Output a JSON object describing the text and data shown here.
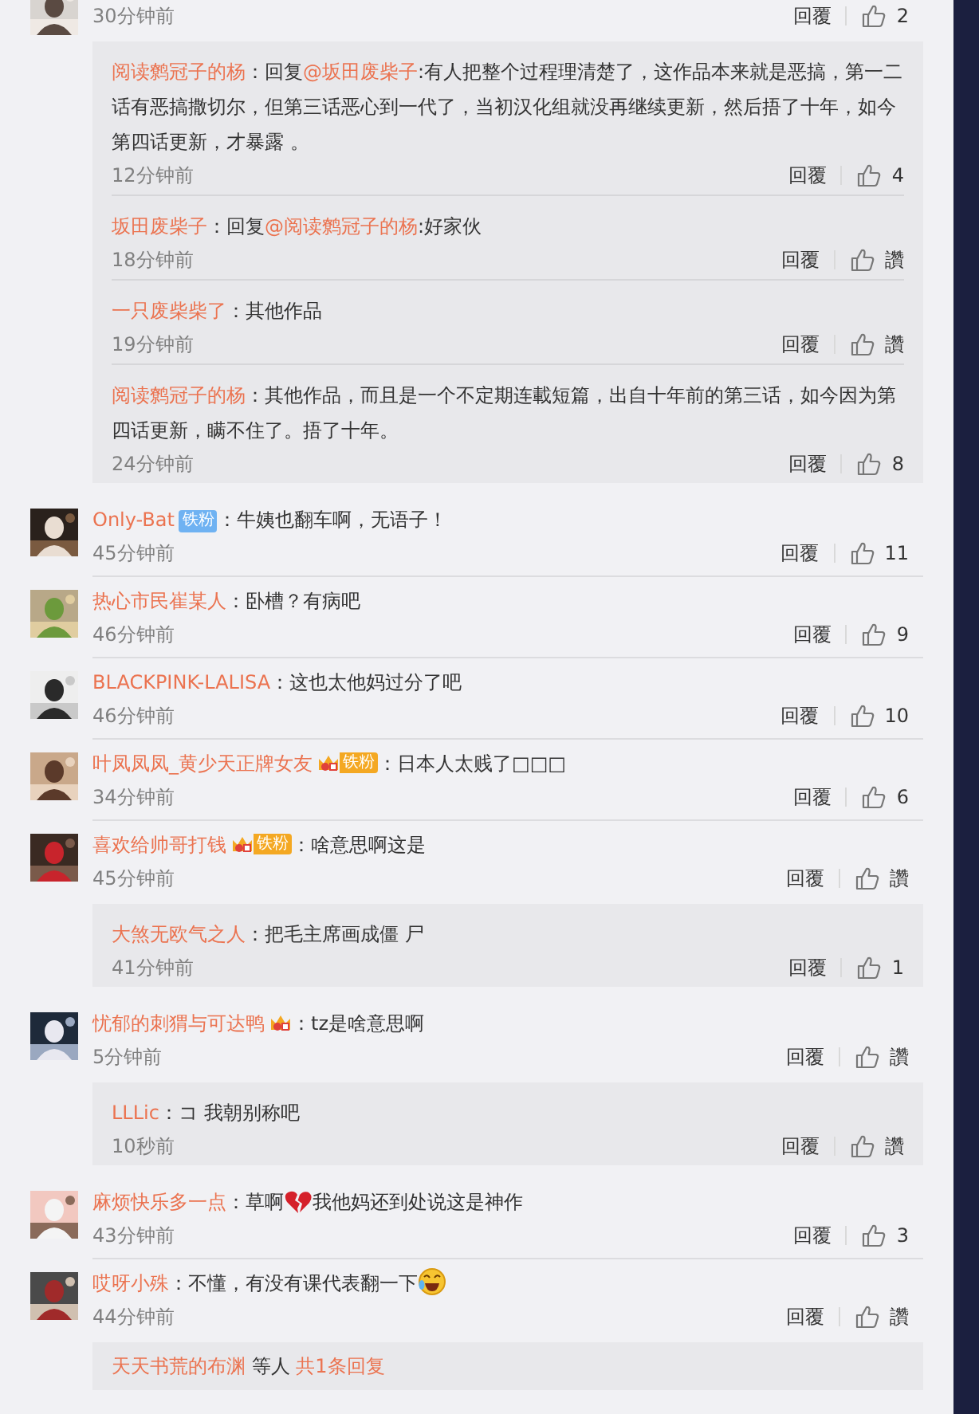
{
  "comments": [
    {
      "time": "30分钟前",
      "reply_label": "回覆",
      "likes": "2",
      "replies": [
        {
          "user": "阅读鹩冠子的杨",
          "prefix": "：回复",
          "mention": "@坂田废柴子",
          "text": ":有人把整个过程理清楚了，这作品本来就是恶搞，第一二话有恶搞撒切尔，但第三话恶心到一代了，当初汉化组就没再继续更新，然后捂了十年，如今第四话更新，才暴露 。",
          "time": "12分钟前",
          "reply_label": "回覆",
          "likes": "4"
        },
        {
          "user": "坂田废柴子",
          "prefix": "：回复",
          "mention": "@阅读鹩冠子的杨",
          "text": ":好家伙",
          "time": "18分钟前",
          "reply_label": "回覆",
          "likes": "讚"
        },
        {
          "user": "一只废柴柴了",
          "text": "：其他作品",
          "time": "19分钟前",
          "reply_label": "回覆",
          "likes": "讚"
        },
        {
          "user": "阅读鹩冠子的杨",
          "text": "：其他作品，而且是一个不定期连載短篇，出自十年前的第三话，如今因为第四话更新，瞒不住了。捂了十年。",
          "time": "24分钟前",
          "reply_label": "回覆",
          "likes": "8"
        }
      ]
    },
    {
      "user": "Only-Bat",
      "badge": {
        "kind": "fan",
        "label": "铁粉"
      },
      "text": "：牛姨也翻车啊，无语子！",
      "time": "45分钟前",
      "reply_label": "回覆",
      "likes": "11"
    },
    {
      "user": "热心市民崔某人",
      "text": "：卧槽？有病吧",
      "time": "46分钟前",
      "reply_label": "回覆",
      "likes": "9"
    },
    {
      "user": "BLACKPINK-LALISA",
      "text": "：这也太他妈过分了吧",
      "time": "46分钟前",
      "reply_label": "回覆",
      "likes": "10"
    },
    {
      "user": "叶凤凤凤_黄少天正牌女友",
      "badge": {
        "kind": "crown-fan",
        "label": "铁粉"
      },
      "text": "：日本人太贱了□□□",
      "time": "34分钟前",
      "reply_label": "回覆",
      "likes": "6"
    },
    {
      "user": "喜欢给帅哥打钱",
      "badge": {
        "kind": "crown-fan",
        "label": "铁粉"
      },
      "text": "：啥意思啊这是",
      "time": "45分钟前",
      "reply_label": "回覆",
      "likes": "讚",
      "replies": [
        {
          "user": "大煞无欧气之人",
          "text": "：把毛主席画成僵 尸",
          "time": "41分钟前",
          "reply_label": "回覆",
          "likes": "1"
        }
      ]
    },
    {
      "user": "忧郁的刺猬与可达鸭",
      "badge": {
        "kind": "crown"
      },
      "text": "：tz是啥意思啊",
      "time": "5分钟前",
      "reply_label": "回覆",
      "likes": "讚",
      "replies": [
        {
          "user": "LLLic",
          "text": "：コ 我朝别称吧",
          "time": "10秒前",
          "reply_label": "回覆",
          "likes": "讚"
        }
      ]
    },
    {
      "user": "麻烦快乐多一点",
      "text": "：草啊",
      "emoji": {
        "kind": "broken-heart"
      },
      "text_after": "我他妈还到处说这是神作",
      "time": "43分钟前",
      "reply_label": "回覆",
      "likes": "3"
    },
    {
      "user": "哎呀小殊",
      "text": "：不懂，有没有课代表翻一下",
      "emoji": {
        "kind": "laughing"
      },
      "time": "44分钟前",
      "reply_label": "回覆",
      "likes": "讚",
      "more_replies": {
        "users": "天天书荒的布渊",
        "middle": "等人",
        "link": "共1条回复"
      }
    }
  ]
}
